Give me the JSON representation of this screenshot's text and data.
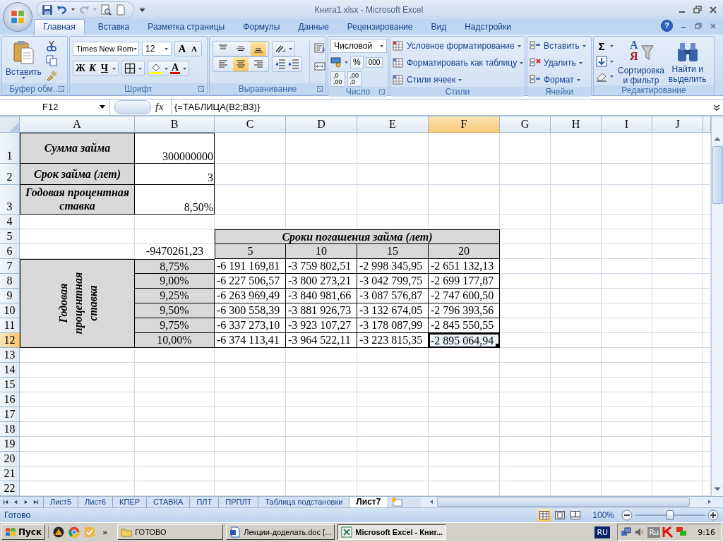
{
  "window": {
    "title": "Книга1.xlsx - Microsoft Excel"
  },
  "tabs": [
    {
      "label": "Главная",
      "selected": true
    },
    {
      "label": "Вставка",
      "selected": false
    },
    {
      "label": "Разметка страницы",
      "selected": false
    },
    {
      "label": "Формулы",
      "selected": false
    },
    {
      "label": "Данные",
      "selected": false
    },
    {
      "label": "Рецензирование",
      "selected": false
    },
    {
      "label": "Вид",
      "selected": false
    },
    {
      "label": "Надстройки",
      "selected": false
    }
  ],
  "help": "?",
  "ribbon": {
    "clipboard": {
      "label": "Буфер обм...",
      "paste": "Вставить"
    },
    "font": {
      "label": "Шрифт",
      "font_name": "Times New Rom",
      "font_size": "12",
      "grow": "A",
      "shrink": "A",
      "bold": "Ж",
      "italic": "К",
      "underline": "Ч",
      "font_color": "A"
    },
    "alignment": {
      "label": "Выравнивание",
      "vertical": [
        {
          "selected": false
        },
        {
          "selected": false
        },
        {
          "selected": true
        }
      ],
      "horizontal": [
        {
          "selected": false
        },
        {
          "selected": true
        },
        {
          "selected": false
        }
      ]
    },
    "number": {
      "label": "Число",
      "format": "Числовой",
      "percent": "%",
      "thousands": "000",
      "increase_decimal": [
        ",0",
        ",00"
      ],
      "decrease_decimal": [
        ",00",
        ",0"
      ]
    },
    "styles": {
      "label": "Стили",
      "items": [
        "Условное форматирование",
        "Форматировать как таблицу",
        "Стили ячеек"
      ]
    },
    "cells": {
      "label": "Ячейки",
      "items": [
        "Вставить",
        "Удалить",
        "Формат"
      ]
    },
    "editing": {
      "label": "Редактирование",
      "sum": "Σ",
      "sort_letters": [
        "А",
        "Я"
      ],
      "sort": [
        "Сортировка",
        "и фильтр"
      ],
      "find": [
        "Найти и",
        "выделить"
      ]
    }
  },
  "formula_bar": {
    "name_box": "F12",
    "function_label": "fx",
    "formula": "{=ТАБЛИЦА(B2;B3)}"
  },
  "sheet": {
    "columns": [
      {
        "label": "A",
        "selected": false
      },
      {
        "label": "B",
        "selected": false
      },
      {
        "label": "C",
        "selected": false
      },
      {
        "label": "D",
        "selected": false
      },
      {
        "label": "E",
        "selected": false
      },
      {
        "label": "F",
        "selected": true
      },
      {
        "label": "G",
        "selected": false
      },
      {
        "label": "H",
        "selected": false
      },
      {
        "label": "I",
        "selected": false
      },
      {
        "label": "J",
        "selected": false
      }
    ],
    "rows": [
      {
        "label": "1",
        "selected": false
      },
      {
        "label": "2",
        "selected": false
      },
      {
        "label": "3",
        "selected": false
      },
      {
        "label": "4",
        "selected": false
      },
      {
        "label": "5",
        "selected": false
      },
      {
        "label": "6",
        "selected": false
      },
      {
        "label": "7",
        "selected": false
      },
      {
        "label": "8",
        "selected": false
      },
      {
        "label": "9",
        "selected": false
      },
      {
        "label": "10",
        "selected": false
      },
      {
        "label": "11",
        "selected": false
      },
      {
        "label": "12",
        "selected": true
      },
      {
        "label": "13",
        "selected": false
      },
      {
        "label": "14",
        "selected": false
      },
      {
        "label": "15",
        "selected": false
      },
      {
        "label": "16",
        "selected": false
      },
      {
        "label": "17",
        "selected": false
      },
      {
        "label": "18",
        "selected": false
      },
      {
        "label": "19",
        "selected": false
      },
      {
        "label": "20",
        "selected": false
      },
      {
        "label": "21",
        "selected": false
      },
      {
        "label": "22",
        "selected": false
      }
    ],
    "inputs": [
      {
        "label": "Сумма займа",
        "value": "300000000"
      },
      {
        "label": "Срок займа (лет)",
        "value": "3"
      },
      {
        "label": "Годовая процентная ставка",
        "value": "8,50%"
      }
    ],
    "data_table": {
      "title": "Сроки погашения займа (лет)",
      "formula_result": "-9470261,23",
      "terms": [
        "5",
        "10",
        "15",
        "20"
      ],
      "side_label": "Годовая процентная ставка",
      "rates": [
        {
          "rate": "8,75%",
          "cells": [
            {
              "text": "-6 191 169,81",
              "selected": false
            },
            {
              "text": "-3 759 802,51",
              "selected": false
            },
            {
              "text": "-2 998 345,95",
              "selected": false
            },
            {
              "text": "-2 651 132,13",
              "selected": false
            }
          ]
        },
        {
          "rate": "9,00%",
          "cells": [
            {
              "text": "-6 227 506,57",
              "selected": false
            },
            {
              "text": "-3 800 273,21",
              "selected": false
            },
            {
              "text": "-3 042 799,75",
              "selected": false
            },
            {
              "text": "-2 699 177,87",
              "selected": false
            }
          ]
        },
        {
          "rate": "9,25%",
          "cells": [
            {
              "text": "-6 263 969,49",
              "selected": false
            },
            {
              "text": "-3 840 981,66",
              "selected": false
            },
            {
              "text": "-3 087 576,87",
              "selected": false
            },
            {
              "text": "-2 747 600,50",
              "selected": false
            }
          ]
        },
        {
          "rate": "9,50%",
          "cells": [
            {
              "text": "-6 300 558,39",
              "selected": false
            },
            {
              "text": "-3 881 926,73",
              "selected": false
            },
            {
              "text": "-3 132 674,05",
              "selected": false
            },
            {
              "text": "-2 796 393,56",
              "selected": false
            }
          ]
        },
        {
          "rate": "9,75%",
          "cells": [
            {
              "text": "-6 337 273,10",
              "selected": false
            },
            {
              "text": "-3 923 107,27",
              "selected": false
            },
            {
              "text": "-3 178 087,99",
              "selected": false
            },
            {
              "text": "-2 845 550,55",
              "selected": false
            }
          ]
        },
        {
          "rate": "10,00%",
          "cells": [
            {
              "text": "-6 374 113,41",
              "selected": false
            },
            {
              "text": "-3 964 522,11",
              "selected": false
            },
            {
              "text": "-3 223 815,35",
              "selected": false
            },
            {
              "text": "-2 895 064,94",
              "selected": true
            }
          ]
        }
      ]
    }
  },
  "sheet_tabs": [
    {
      "label": "Лист5",
      "selected": false
    },
    {
      "label": "Лист6",
      "selected": false
    },
    {
      "label": "КПЕР",
      "selected": false
    },
    {
      "label": "СТАВКА",
      "selected": false
    },
    {
      "label": "ПЛТ",
      "selected": false
    },
    {
      "label": "ПРПЛТ",
      "selected": false
    },
    {
      "label": "Таблица подстановки",
      "selected": false
    },
    {
      "label": "Лист7",
      "selected": true
    }
  ],
  "status_bar": {
    "text": "Готово",
    "views": [
      {
        "selected": true
      },
      {
        "selected": false
      },
      {
        "selected": false
      }
    ],
    "zoom": "100%",
    "zoom_slider": {
      "level": 0.5
    }
  },
  "taskbar": {
    "start": "Пуск",
    "more": "»",
    "tasks": [
      {
        "label": "ГОТОВО",
        "kind": "folder",
        "selected": false
      },
      {
        "label": "Лекции-доделать.doc [...",
        "kind": "document",
        "selected": false
      },
      {
        "label": "Microsoft Excel - Книг...",
        "kind": "sheet",
        "selected": true
      }
    ],
    "language": "RU",
    "tray_language": "Ru",
    "clock": "9:16"
  }
}
